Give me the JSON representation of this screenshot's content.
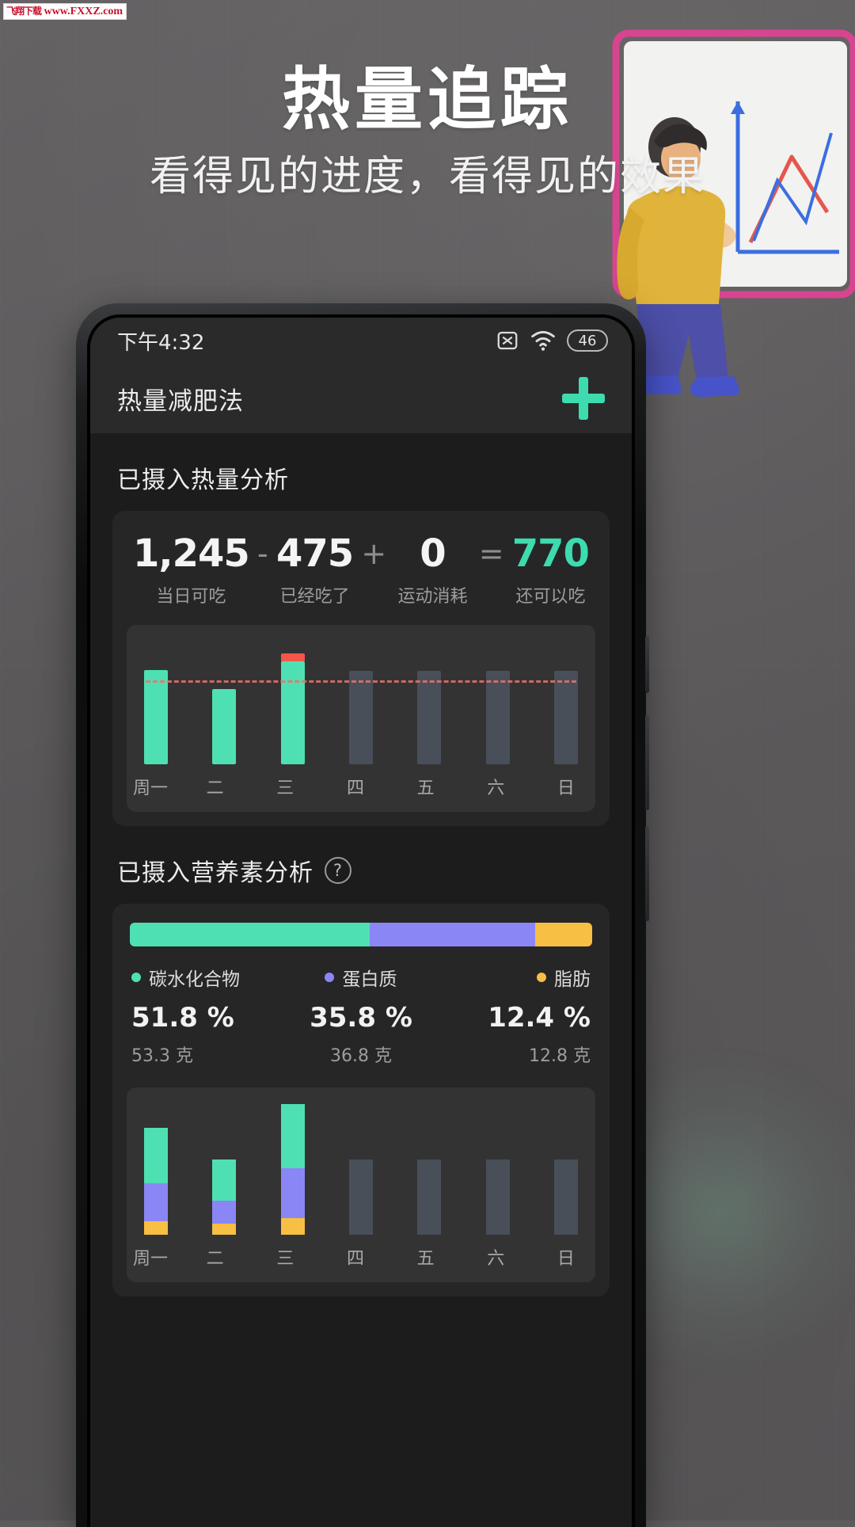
{
  "watermark": {
    "cn": "飞翔下载",
    "url": "www.FXXZ.com"
  },
  "promo": {
    "headline": "热量追踪",
    "subheadline": "看得见的进度，看得见的效果"
  },
  "phone": {
    "status": {
      "time": "下午4:32",
      "icons": [
        "no-sim-icon",
        "wifi-icon"
      ],
      "battery": "46"
    },
    "header": {
      "title": "热量减肥法",
      "add_label": "+"
    },
    "calorie_section": {
      "title": "已摄入热量分析",
      "items": [
        {
          "value": "1,245",
          "label": "当日可吃",
          "op": "-",
          "accent": false
        },
        {
          "value": "475",
          "label": "已经吃了",
          "op": "+",
          "accent": false
        },
        {
          "value": "0",
          "label": "运动消耗",
          "op": "=",
          "accent": false
        },
        {
          "value": "770",
          "label": "还可以吃",
          "op": "",
          "accent": true
        }
      ]
    },
    "nutrient_section": {
      "title": "已摄入营养素分析",
      "help": "?",
      "legend": [
        {
          "name": "碳水化合物",
          "percent": "51.8 %",
          "grams": "53.3 克",
          "color": "#4ee0b2"
        },
        {
          "name": "蛋白质",
          "percent": "35.8 %",
          "grams": "36.8 克",
          "color": "#8b86f5"
        },
        {
          "name": "脂肪",
          "percent": "12.4 %",
          "grams": "12.8 克",
          "color": "#f7bf44"
        }
      ]
    }
  },
  "chart_data": [
    {
      "type": "bar",
      "title": "已摄入热量分析",
      "categories": [
        "周一",
        "二",
        "三",
        "四",
        "五",
        "六",
        "日"
      ],
      "values": [
        475,
        380,
        560,
        0,
        0,
        0,
        0
      ],
      "goal_line": 520,
      "ylim": [
        0,
        640
      ],
      "bar_colors": [
        "#4ee0b2",
        "#4ee0b2",
        "#4ee0b2",
        "#4c5560",
        "#4c5560",
        "#4c5560",
        "#4c5560"
      ],
      "overflow_color": "#f4564a",
      "placeholder_color": "#4c5560",
      "xlabel": "",
      "ylabel": "",
      "grid": false,
      "legend": "none"
    },
    {
      "type": "bar",
      "title": "已摄入营养素分析",
      "stacked": true,
      "categories": [
        "周一",
        "二",
        "三",
        "四",
        "五",
        "六",
        "日"
      ],
      "series": [
        {
          "name": "碳水化合物",
          "color": "#4ee0b2",
          "values": [
            53.3,
            40.0,
            62.0,
            0,
            0,
            0,
            0
          ]
        },
        {
          "name": "蛋白质",
          "color": "#8b86f5",
          "values": [
            36.8,
            22.0,
            48.0,
            0,
            0,
            0,
            0
          ]
        },
        {
          "name": "脂肪",
          "color": "#f7bf44",
          "values": [
            12.8,
            11.0,
            16.0,
            0,
            0,
            0,
            0
          ]
        }
      ],
      "placeholder_color": "#4c5560",
      "placeholder_height": [
        0,
        0,
        0,
        95,
        95,
        95,
        95
      ],
      "ylim": [
        0,
        130
      ],
      "grid": false,
      "legend": "top"
    }
  ]
}
